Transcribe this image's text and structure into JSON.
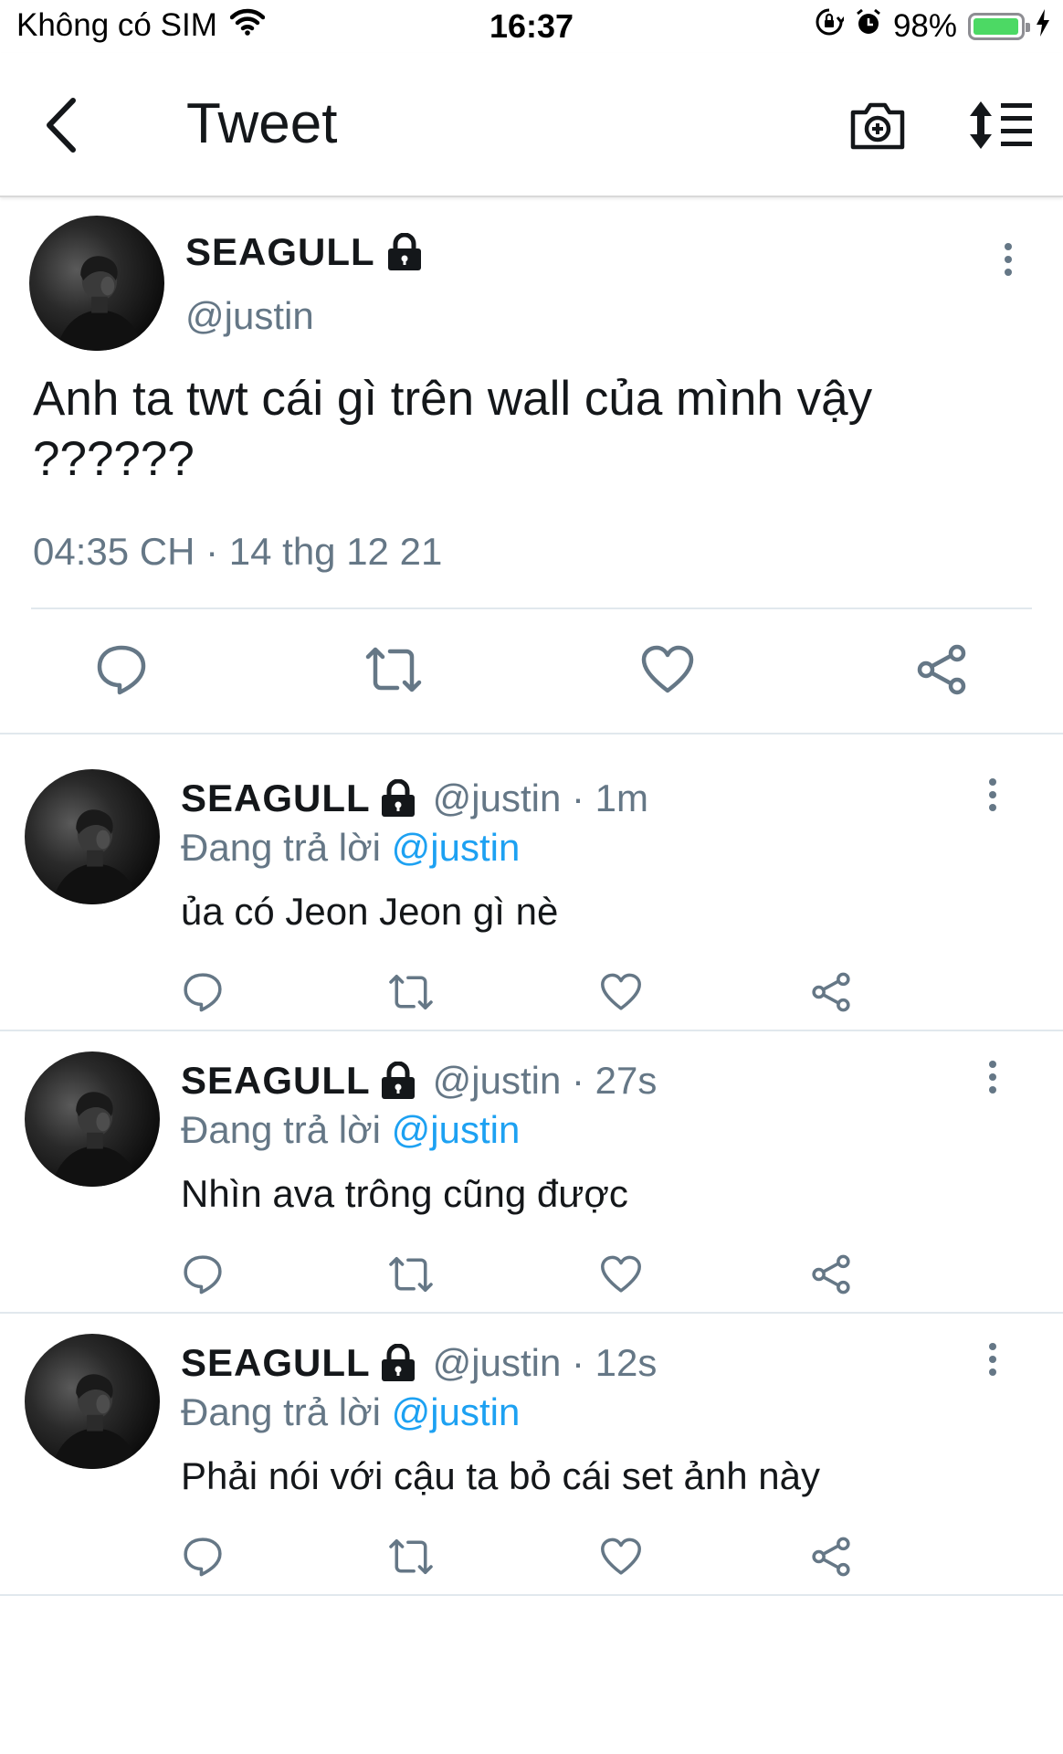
{
  "status_bar": {
    "carrier": "Không có SIM",
    "time": "16:37",
    "battery_percent": "98%",
    "battery_level": 0.98,
    "battery_color": "#4cd964"
  },
  "nav": {
    "title": "Tweet",
    "back_icon": "chevron-left-icon",
    "camera_icon": "camera-plus-icon",
    "sort_icon": "sort-list-icon"
  },
  "main_tweet": {
    "name": "SEAGULL",
    "handle": "@justin",
    "text": "Anh ta twt cái gì trên wall của mình vậy ??????",
    "timestamp": "04:35 CH · 14 thg 12 21"
  },
  "replies": [
    {
      "name": "SEAGULL",
      "handle_time": "@justin · 1m",
      "replying_prefix": "Đang trả lời",
      "replying_to": "@justin",
      "text": "ủa có Jeon Jeon gì nè"
    },
    {
      "name": "SEAGULL",
      "handle_time": "@justin · 27s",
      "replying_prefix": "Đang trả lời",
      "replying_to": "@justin",
      "text": "Nhìn ava trông cũng được"
    },
    {
      "name": "SEAGULL",
      "handle_time": "@justin · 12s",
      "replying_prefix": "Đang trả lời",
      "replying_to": "@justin",
      "text": "Phải nói với cậu ta bỏ cái set ảnh này"
    }
  ],
  "colors": {
    "accent": "#1da1f2",
    "secondary_text": "#657786",
    "icon": "#657786"
  }
}
